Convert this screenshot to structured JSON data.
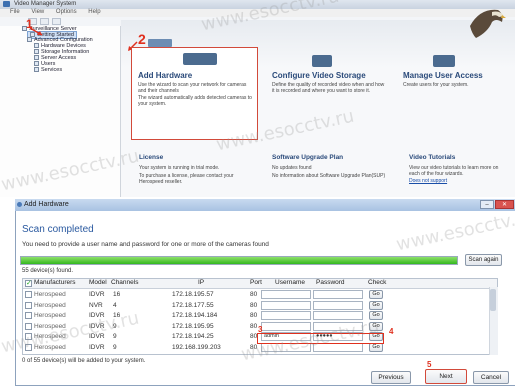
{
  "top_window": {
    "title": "Video Manager System",
    "menu": [
      "File",
      "View",
      "Options",
      "Help"
    ],
    "tree": [
      {
        "label": "Surveillance Server",
        "indent": 0
      },
      {
        "label": "Getting Started",
        "indent": 1,
        "selected": true
      },
      {
        "label": "Advanced Configuration",
        "indent": 1
      },
      {
        "label": "Hardware Devices",
        "indent": 2
      },
      {
        "label": "Storage Information",
        "indent": 2
      },
      {
        "label": "Server Access",
        "indent": 2
      },
      {
        "label": "Users",
        "indent": 2
      },
      {
        "label": "Services",
        "indent": 2
      }
    ],
    "cards": {
      "add_hardware": {
        "title": "Add Hardware",
        "desc1": "Use the wizard to scan your network for cameras and their channels",
        "desc2": "The wizard automatically adds detected cameras to your system."
      },
      "configure_storage": {
        "title": "Configure Video Storage",
        "desc": "Define the quality of recorded video when and how it is recorded and where you want to store it."
      },
      "manage_users": {
        "title": "Manage User Access",
        "desc": "Create users for your system."
      }
    },
    "license": {
      "title": "License",
      "line1": "Your system is running in trial mode.",
      "line2": "To purchase a license, please contact your Herospeed reseller."
    },
    "upgrade": {
      "title": "Software Upgrade Plan",
      "line1": "No updates found",
      "line2": "No information about Software Upgrade Plan(SUP)"
    },
    "tutorials": {
      "title": "Video Tutorials",
      "line1": "View our video tutorials to learn more on each of the four wizards.",
      "link": "Does not support"
    }
  },
  "dialog": {
    "title": "Add Hardware",
    "heading": "Scan completed",
    "description": "You need to provide a user name and password for one or more of the cameras found",
    "progress_percent": 100,
    "scan_again": "Scan again",
    "found": "55 device(s) found.",
    "columns": [
      "Manufacturers",
      "Model",
      "Channels",
      "IP",
      "Port",
      "Username",
      "Password",
      "Check"
    ],
    "rows": [
      {
        "manufacturer": "Herospeed",
        "model": "IDVR",
        "channels": "16",
        "ip": "172.18.195.57",
        "port": "80",
        "username": "",
        "password": "",
        "check": "Go"
      },
      {
        "manufacturer": "Herospeed",
        "model": "NVR",
        "channels": "4",
        "ip": "172.18.177.55",
        "port": "80",
        "username": "",
        "password": "",
        "check": "Go"
      },
      {
        "manufacturer": "Herospeed",
        "model": "IDVR",
        "channels": "16",
        "ip": "172.18.194.184",
        "port": "80",
        "username": "",
        "password": "",
        "check": "Go"
      },
      {
        "manufacturer": "Herospeed",
        "model": "IDVR",
        "channels": "9",
        "ip": "172.18.195.95",
        "port": "80",
        "username": "",
        "password": "",
        "check": "Go"
      },
      {
        "manufacturer": "Herospeed",
        "model": "IDVR",
        "channels": "9",
        "ip": "172.18.194.25",
        "port": "80",
        "username": "admin",
        "password": "●●●●●",
        "check": "Go"
      },
      {
        "manufacturer": "Herospeed",
        "model": "IDVR",
        "channels": "9",
        "ip": "192.168.199.203",
        "port": "80",
        "username": "",
        "password": "",
        "check": "Go"
      }
    ],
    "selected_summary": "0 of 55 device(s) will be added to your system.",
    "buttons": {
      "previous": "Previous",
      "next": "Next",
      "cancel": "Cancel"
    }
  },
  "annotations": {
    "step1": "1",
    "step2": "2",
    "step3": "3",
    "step4": "4",
    "step5": "5"
  },
  "watermark": "www.esocctv.ru",
  "colors": {
    "accent_red": "#e0301e",
    "progress_green": "#34b81e",
    "title_blue": "#2b5aa0"
  }
}
